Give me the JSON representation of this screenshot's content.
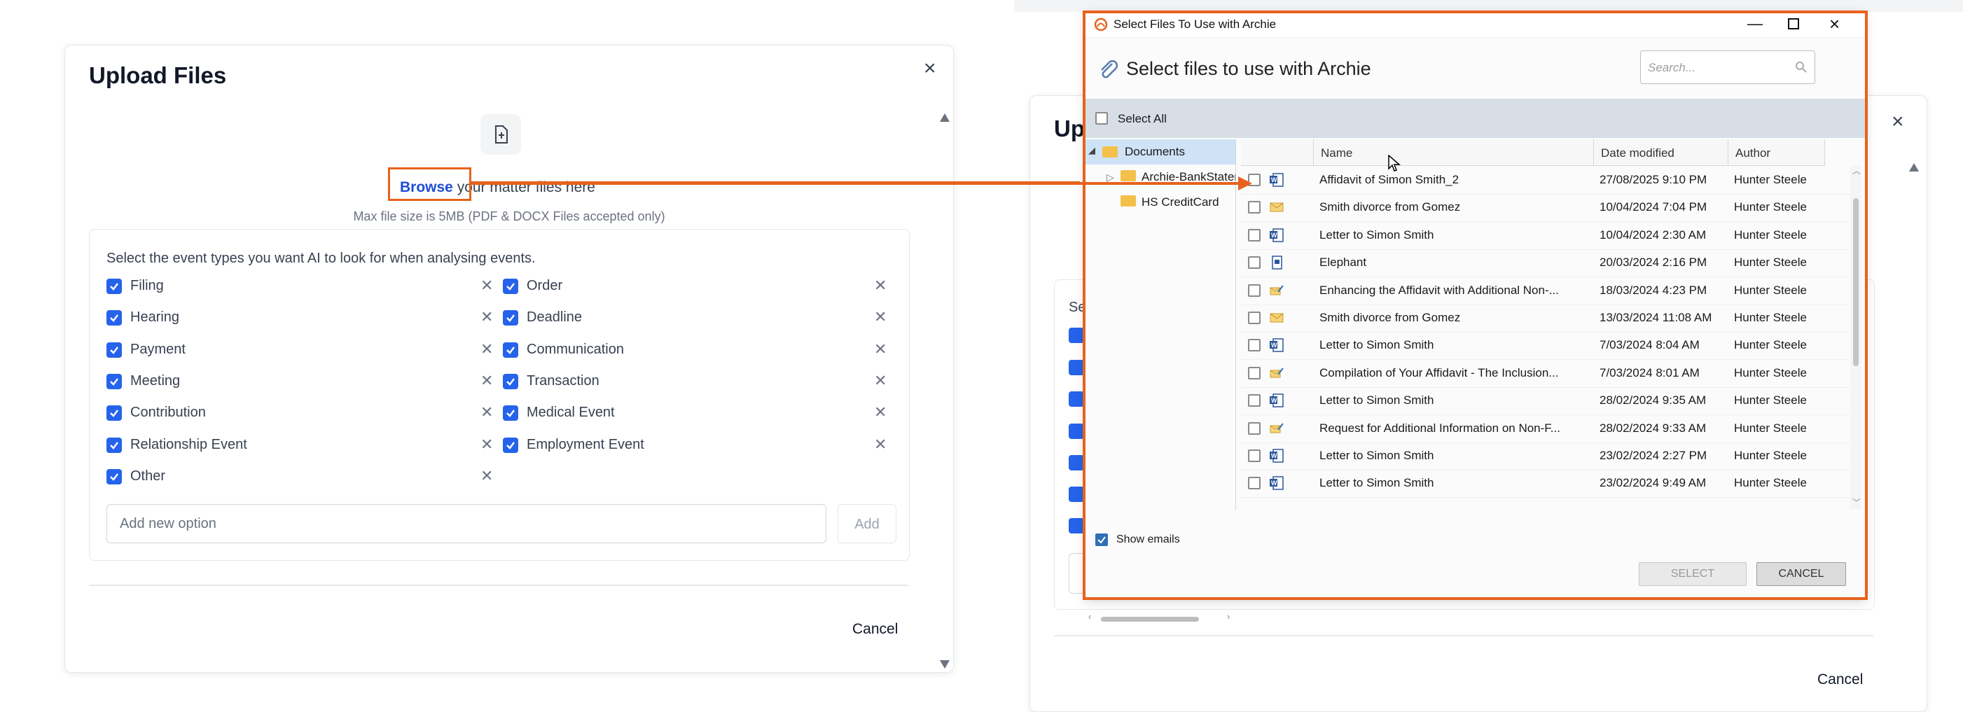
{
  "left_modal": {
    "title": "Upload Files",
    "browse_link": "Browse",
    "browse_rest": " your matter files here",
    "max_size": "Max file size is 5MB (PDF & DOCX Files accepted only)",
    "events_prompt": "Select the event types you want AI to look for when analysing events.",
    "events_left": [
      "Filing",
      "Hearing",
      "Payment",
      "Meeting",
      "Contribution",
      "Relationship Event",
      "Other"
    ],
    "events_right": [
      "Order",
      "Deadline",
      "Communication",
      "Transaction",
      "Medical Event",
      "Employment Event"
    ],
    "add_placeholder": "Add new option",
    "add_button": "Add",
    "cancel": "Cancel"
  },
  "right_modal": {
    "title_partial": "Up",
    "section_partial": "Se",
    "cancel": "Cancel"
  },
  "dialog": {
    "window_title": "Select Files To Use with Archie",
    "header": "Select files to use with Archie",
    "search_placeholder": "Search...",
    "select_all": "Select All",
    "tree": [
      "Documents",
      "Archie-BankStatements",
      "HS CreditCard"
    ],
    "columns": [
      "Name",
      "Date modified",
      "Author"
    ],
    "files": [
      {
        "name": "Affidavit of Simon Smith_2",
        "date": "27/08/2025 9:10 PM",
        "author": "Hunter Steele",
        "icon": "word-icon"
      },
      {
        "name": "Smith divorce from Gomez",
        "date": "10/04/2024 7:04 PM",
        "author": "Hunter Steele",
        "icon": "email-icon"
      },
      {
        "name": "Letter to Simon Smith",
        "date": "10/04/2024 2:30 AM",
        "author": "Hunter Steele",
        "icon": "word-icon"
      },
      {
        "name": "Elephant",
        "date": "20/03/2024 2:16 PM",
        "author": "Hunter Steele",
        "icon": "doc-icon"
      },
      {
        "name": "Enhancing the Affidavit with Additional Non-...",
        "date": "18/03/2024 4:23 PM",
        "author": "Hunter Steele",
        "icon": "email-edit-icon"
      },
      {
        "name": "Smith divorce from Gomez",
        "date": "13/03/2024 11:08 AM",
        "author": "Hunter Steele",
        "icon": "email-icon"
      },
      {
        "name": "Letter to Simon Smith",
        "date": "7/03/2024 8:04 AM",
        "author": "Hunter Steele",
        "icon": "word-icon"
      },
      {
        "name": "Compilation of Your Affidavit - The Inclusion...",
        "date": "7/03/2024 8:01 AM",
        "author": "Hunter Steele",
        "icon": "email-edit-icon"
      },
      {
        "name": "Letter to Simon Smith",
        "date": "28/02/2024 9:35 AM",
        "author": "Hunter Steele",
        "icon": "word-icon"
      },
      {
        "name": "Request for Additional Information on Non-F...",
        "date": "28/02/2024 9:33 AM",
        "author": "Hunter Steele",
        "icon": "email-edit-icon"
      },
      {
        "name": "Letter to Simon Smith",
        "date": "23/02/2024 2:27 PM",
        "author": "Hunter Steele",
        "icon": "word-icon"
      },
      {
        "name": "Letter to Simon Smith",
        "date": "23/02/2024 9:49 AM",
        "author": "Hunter Steele",
        "icon": "word-icon"
      }
    ],
    "show_emails": "Show emails",
    "select_button": "SELECT",
    "cancel_button": "CANCEL"
  },
  "colors": {
    "accent_orange": "#e8621c",
    "checkbox_blue": "#2563eb",
    "link_blue": "#1d4ed8"
  }
}
